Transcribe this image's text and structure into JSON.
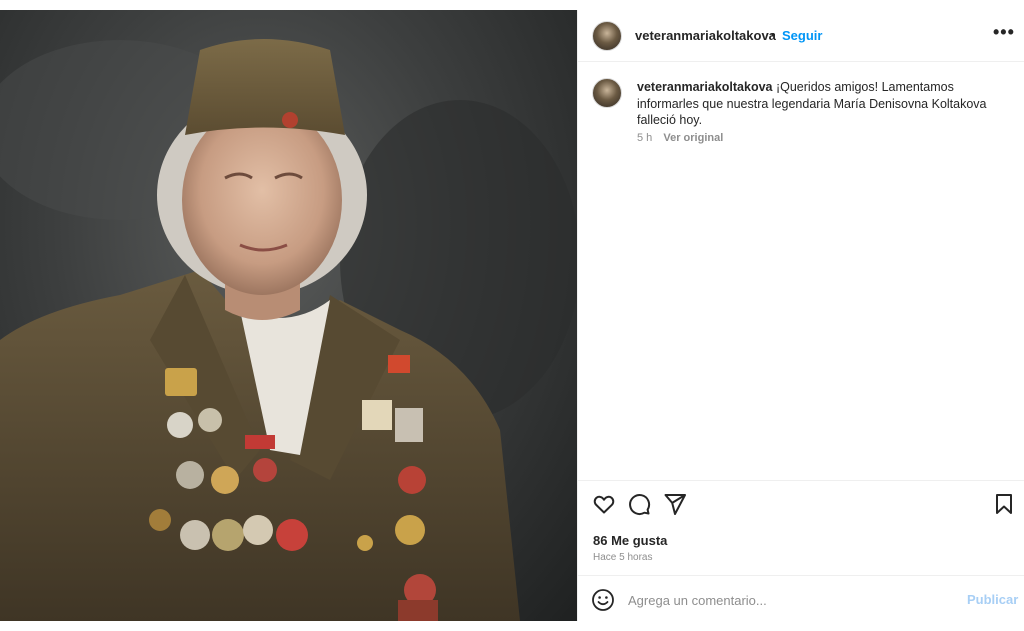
{
  "post": {
    "username": "veteranmariakoltakova",
    "separator": "•",
    "follow_label": "Seguir",
    "more_label": "•••",
    "caption": {
      "username": "veteranmariakoltakova",
      "text": " ¡Queridos amigos! Lamentamos informarles que nuestra legendaria María Denisovna Koltakova falleció hoy.",
      "time": "5 h",
      "see_original": "Ver original"
    },
    "actions": {
      "like_icon": "heart-icon",
      "comment_icon": "comment-icon",
      "share_icon": "send-icon",
      "save_icon": "bookmark-icon"
    },
    "likes": "86 Me gusta",
    "posted_ago": "Hace 5 horas",
    "comment_box": {
      "placeholder": "Agrega un comentario...",
      "publish_label": "Publicar",
      "emoji_icon": "smiley-icon"
    }
  },
  "colors": {
    "link_blue": "#0095f6",
    "publish_disabled": "#a8cff5",
    "muted": "#8e8e8e",
    "text": "#262626"
  }
}
